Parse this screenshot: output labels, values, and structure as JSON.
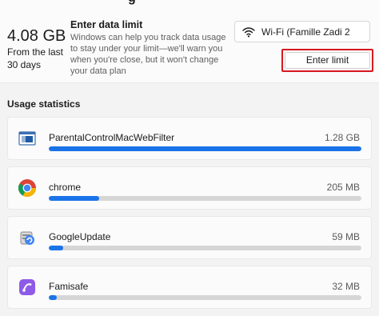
{
  "summary": {
    "cut_heading": "g",
    "total_usage": "4.08 GB",
    "period": "From the last 30 days"
  },
  "limit": {
    "title": "Enter data limit",
    "description": "Windows can help you track data usage to stay under your limit—we'll warn you when you're close, but it won't change your data plan",
    "button_label": "Enter limit"
  },
  "network": {
    "icon": "wifi-icon",
    "selected": "Wi-Fi (Famille Zadi 2"
  },
  "usage": {
    "section_title": "Usage statistics",
    "accent_color": "#1a73e8",
    "apps": [
      {
        "name": "ParentalControlMacWebFilter",
        "amount": "1.28 GB",
        "fraction": 1.0,
        "icon": "parental-control-app-icon"
      },
      {
        "name": "chrome",
        "amount": "205 MB",
        "fraction": 0.16,
        "icon": "chrome-icon"
      },
      {
        "name": "GoogleUpdate",
        "amount": "59 MB",
        "fraction": 0.046,
        "icon": "google-update-icon"
      },
      {
        "name": "Famisafe",
        "amount": "32 MB",
        "fraction": 0.025,
        "icon": "famisafe-icon"
      }
    ]
  }
}
